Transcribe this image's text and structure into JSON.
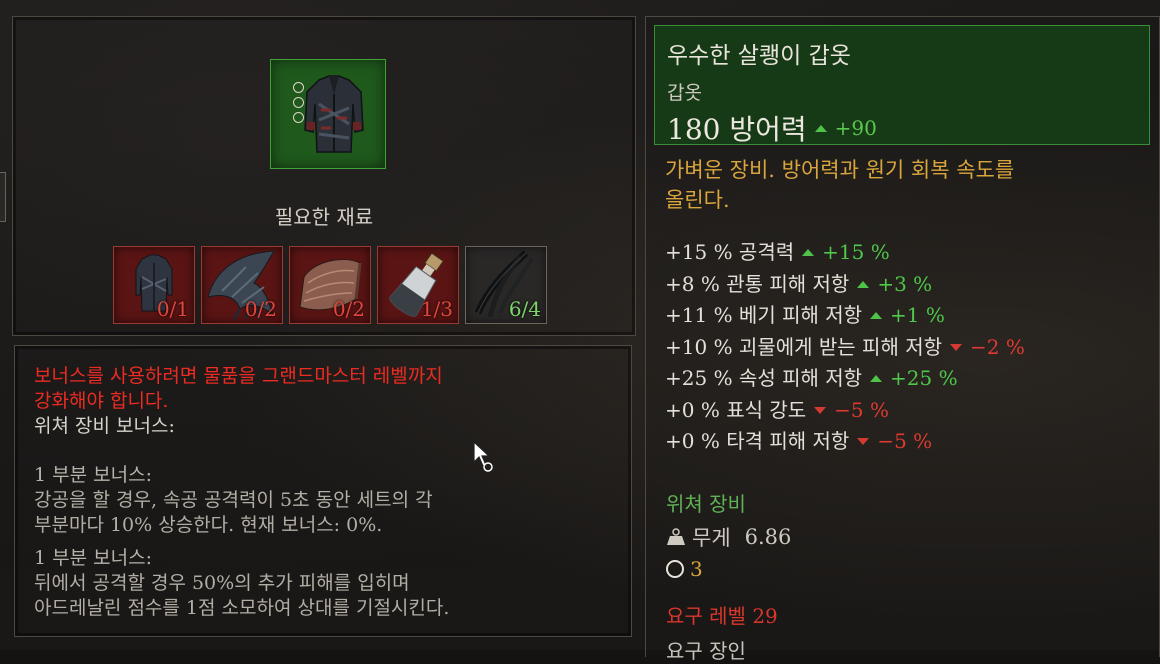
{
  "crafting": {
    "materials_label": "필요한 재료",
    "materials": [
      {
        "icon": "leather-armor-icon",
        "count": "0/1",
        "met": false
      },
      {
        "icon": "beast-claw-icon",
        "count": "0/2",
        "met": false
      },
      {
        "icon": "hide-scrap-icon",
        "count": "0/2",
        "met": false
      },
      {
        "icon": "potion-vial-icon",
        "count": "1/3",
        "met": false
      },
      {
        "icon": "leather-strap-icon",
        "count": "6/4",
        "met": true
      }
    ]
  },
  "bonus": {
    "warning_line1": "보너스를 사용하려면 물품을 그랜드마스터 레벨까지",
    "warning_line2": "강화해야 합니다.",
    "set_title": "위쳐 장비 보너스:",
    "bonus1_title": "1 부분 보너스:",
    "bonus1_desc_line1": "강공을 할 경우, 속공 공격력이 5초 동안 세트의 각",
    "bonus1_desc_line2": "부분마다 10% 상승한다. 현재 보너스: 0%.",
    "bonus2_title": "1 부분 보너스:",
    "bonus2_desc_line1": "뒤에서 공격할 경우 50%의 추가 피해를 입히며",
    "bonus2_desc_line2": "아드레날린 점수를 1점 소모하여 상대를 기절시킨다."
  },
  "tooltip": {
    "name": "우수한 살쾡이 갑옷",
    "type": "갑옷",
    "armor_value": "180 방어력",
    "armor_delta": "+90",
    "description_line1": "가벼운 장비. 방어력과 원기 회복 속도를",
    "description_line2": "올린다.",
    "stats": [
      {
        "label": "+15 % 공격력",
        "delta": "+15 %",
        "trend": "up"
      },
      {
        "label": "+8 % 관통 피해 저항",
        "delta": "+3 %",
        "trend": "up"
      },
      {
        "label": "+11 % 베기 피해 저항",
        "delta": "+1 %",
        "trend": "up"
      },
      {
        "label": "+10 % 괴물에게 받는 피해 저항",
        "delta": "−2 %",
        "trend": "down"
      },
      {
        "label": "+25 % 속성 피해 저항",
        "delta": "+25 %",
        "trend": "up"
      },
      {
        "label": "+0 % 표식 강도",
        "delta": "−5 %",
        "trend": "down"
      },
      {
        "label": "+0 % 타격 피해 저항",
        "delta": "−5 %",
        "trend": "down"
      }
    ],
    "gear_type": "위쳐 장비",
    "weight_label": "무게",
    "weight_value": "6.86",
    "sockets": "3",
    "required_level": "요구 레벨 29",
    "extra_line": "요구 장인"
  },
  "colors": {
    "item_slot": "#1f5a1c",
    "missing_material": "#5a1414",
    "positive": "#4fc74a",
    "negative": "#dd3a32",
    "description": "#d9a53c",
    "warning": "#ee2b22"
  }
}
